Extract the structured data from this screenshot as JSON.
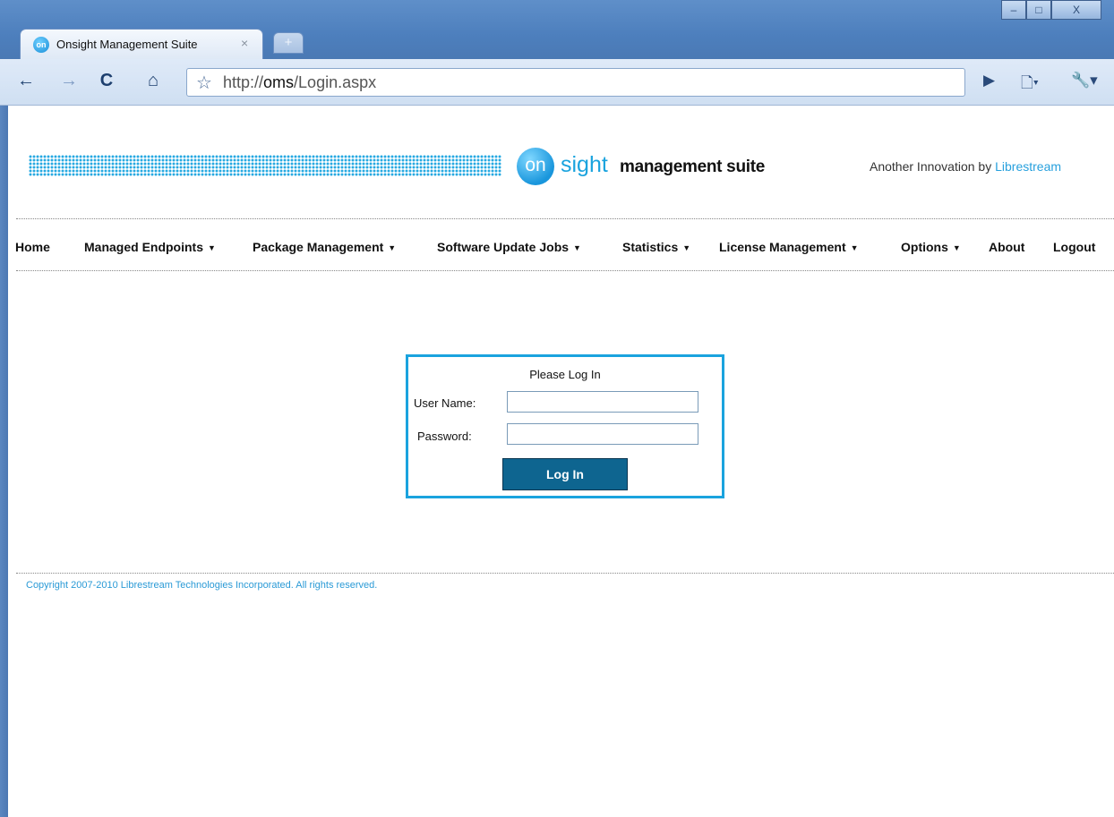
{
  "browser": {
    "tab_title": "Onsight Management Suite",
    "tab_close": "×",
    "new_tab": "+",
    "favicon_text": "on",
    "window_buttons": {
      "minimize": "–",
      "maximize": "□",
      "close": "X"
    },
    "url_prefix": "http://",
    "url_host": "oms",
    "url_path": "/Login.aspx",
    "nav": {
      "back": "←",
      "forward": "→",
      "reload": "C",
      "home": "⌂",
      "star": "☆"
    },
    "right_tools": {
      "play": "▶",
      "page": "🗋▾",
      "wrench": "🔧▾"
    }
  },
  "header": {
    "logo_on": "on",
    "logo_sight": "sight",
    "logo_suite": "management suite",
    "tagline_prefix": "Another Innovation by ",
    "tagline_brand": "Librestream"
  },
  "menu": {
    "items": [
      {
        "label": "Home",
        "dropdown": false
      },
      {
        "label": "Managed Endpoints",
        "dropdown": true
      },
      {
        "label": "Package Management",
        "dropdown": true
      },
      {
        "label": "Software Update Jobs",
        "dropdown": true
      },
      {
        "label": "Statistics",
        "dropdown": true
      },
      {
        "label": "License Management",
        "dropdown": true
      },
      {
        "label": "Options",
        "dropdown": true
      },
      {
        "label": "About",
        "dropdown": false
      },
      {
        "label": "Logout",
        "dropdown": false
      }
    ],
    "caret": "▼"
  },
  "login": {
    "title": "Please Log In",
    "username_label": "User Name:",
    "username_value": "",
    "password_label": "Password:",
    "password_value": "",
    "button_label": "Log In"
  },
  "footer": {
    "copyright": "Copyright 2007-2010 Librestream Technologies Incorporated. All rights reserved."
  },
  "colors": {
    "accent": "#1aa3de",
    "button": "#0e6590",
    "chrome": "#4d7fbd"
  }
}
